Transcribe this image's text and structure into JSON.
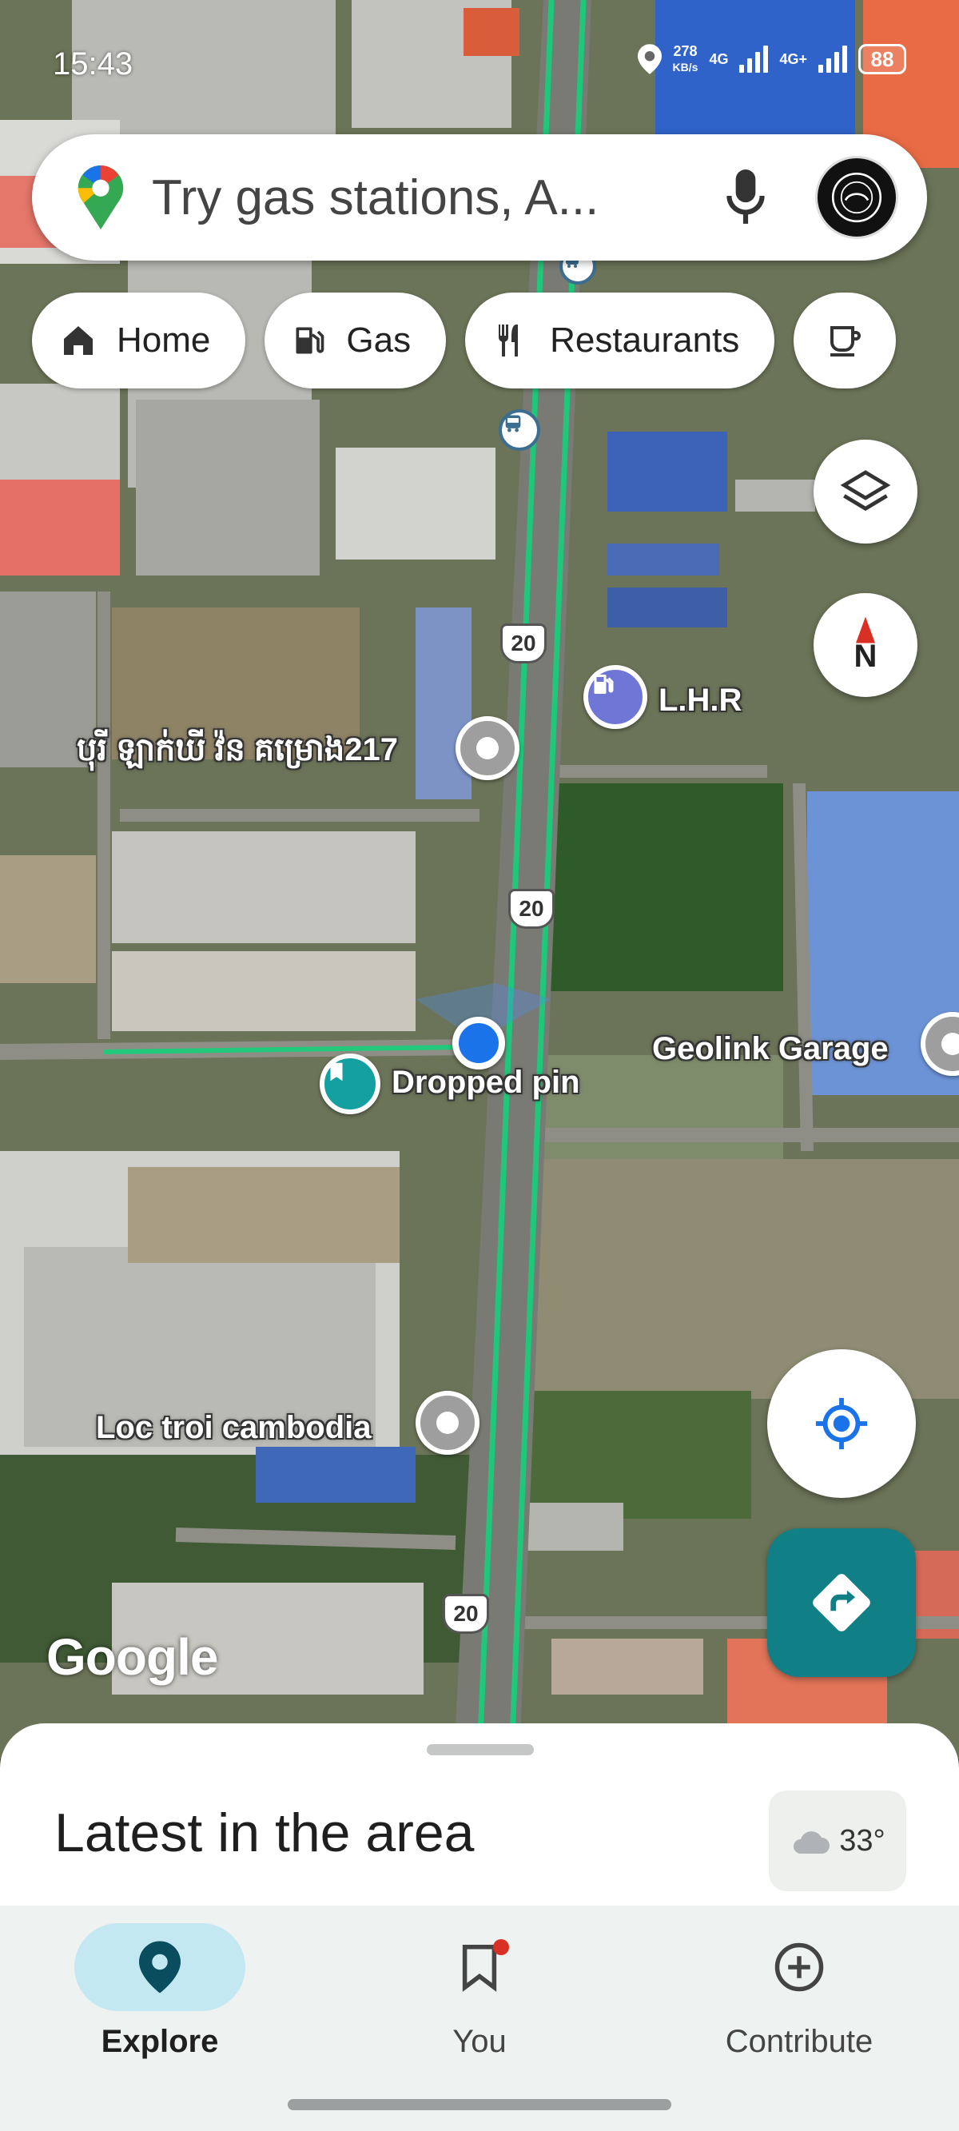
{
  "status_bar": {
    "time": "15:43",
    "data_rate_value": "278",
    "data_rate_unit": "KB/s",
    "network_1": "4G",
    "network_2": "4G+",
    "battery": "88"
  },
  "search": {
    "placeholder": "Try gas stations, A...",
    "icons": [
      "maps-pin-logo",
      "microphone-icon",
      "account-avatar"
    ]
  },
  "chips": [
    {
      "label": "Home",
      "icon": "home-icon"
    },
    {
      "label": "Gas",
      "icon": "gas-pump-icon"
    },
    {
      "label": "Restaurants",
      "icon": "fork-knife-icon"
    },
    {
      "label": "",
      "icon": "coffee-icon"
    }
  ],
  "map": {
    "labels": {
      "lhr": "L.H.R",
      "khmer_place": "បុរី ឡាក់ឃី វ៉ន គម្រោង217",
      "geolink": "Geolink Garage",
      "dropped_pin": "Dropped pin",
      "loc_troi": "Loc troi cambodia"
    },
    "route_number": "20",
    "attribution": "Google"
  },
  "compass_label": "N",
  "bottom_sheet": {
    "title": "Latest in the area",
    "weather_temp": "33°"
  },
  "nav": [
    {
      "label": "Explore",
      "icon": "explore-pin-icon",
      "active": true
    },
    {
      "label": "You",
      "icon": "bookmark-icon",
      "active": false
    },
    {
      "label": "Contribute",
      "icon": "add-circle-icon",
      "active": false
    }
  ],
  "colors": {
    "route_green": "#1ec77a",
    "accent_teal": "#117f86",
    "location_blue": "#1a73e8",
    "nav_active_bg": "#c4e8f2"
  }
}
